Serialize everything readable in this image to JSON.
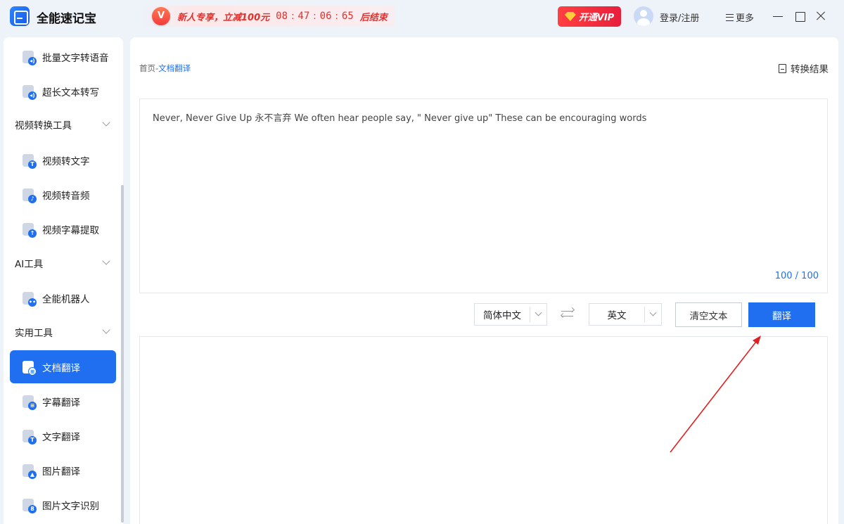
{
  "app": {
    "name": "全能速记宝"
  },
  "promo": {
    "badge": "V",
    "text": "新人专享，立减100元",
    "countdown": [
      "08",
      "47",
      "06",
      "65"
    ],
    "separator": ":",
    "end_text": "后结束"
  },
  "header": {
    "vip_label": "开通VIP",
    "login_label": "登录/注册",
    "more_label": "更多"
  },
  "sidebar": {
    "items": [
      {
        "label": "批量文字转语音",
        "icon": "audio-doc-icon",
        "badge": "◂)"
      },
      {
        "label": "超长文本转写",
        "icon": "audio-doc-icon",
        "badge": "◂)"
      },
      {
        "label": "视频转换工具",
        "group": true
      },
      {
        "label": "视频转文字",
        "icon": "text-doc-icon",
        "badge": "T"
      },
      {
        "label": "视频转音频",
        "icon": "music-doc-icon",
        "badge": "♪"
      },
      {
        "label": "视频字幕提取",
        "icon": "upload-doc-icon",
        "badge": "↑"
      },
      {
        "label": "AI工具",
        "group": true
      },
      {
        "label": "全能机器人",
        "icon": "robot-icon",
        "badge": "••"
      },
      {
        "label": "实用工具",
        "group": true
      },
      {
        "label": "文档翻译",
        "icon": "doc-translate-icon",
        "badge": "≡",
        "active": true
      },
      {
        "label": "字幕翻译",
        "icon": "subtitle-icon",
        "badge": "≡"
      },
      {
        "label": "文字翻译",
        "icon": "text-translate-icon",
        "badge": "T"
      },
      {
        "label": "图片翻译",
        "icon": "image-translate-icon",
        "badge": "▲"
      },
      {
        "label": "图片文字识别",
        "icon": "ocr-icon",
        "badge": "8"
      }
    ]
  },
  "main": {
    "breadcrumb_home": "首页",
    "breadcrumb_sep": "-",
    "breadcrumb_current": "文档翻译",
    "result_label": "转换结果",
    "source_text": "Never, Never Give Up 永不言弃 We often hear people say, \" Never give up\" These can be encouraging words",
    "char_count": "100 / 100",
    "source_lang": "简体中文",
    "target_lang": "英文",
    "clear_label": "清空文本",
    "translate_label": "翻译",
    "target_text": ""
  },
  "colors": {
    "accent": "#1f6ff0",
    "promo_red": "#e0322f",
    "annotation_arrow": "#e02020"
  }
}
